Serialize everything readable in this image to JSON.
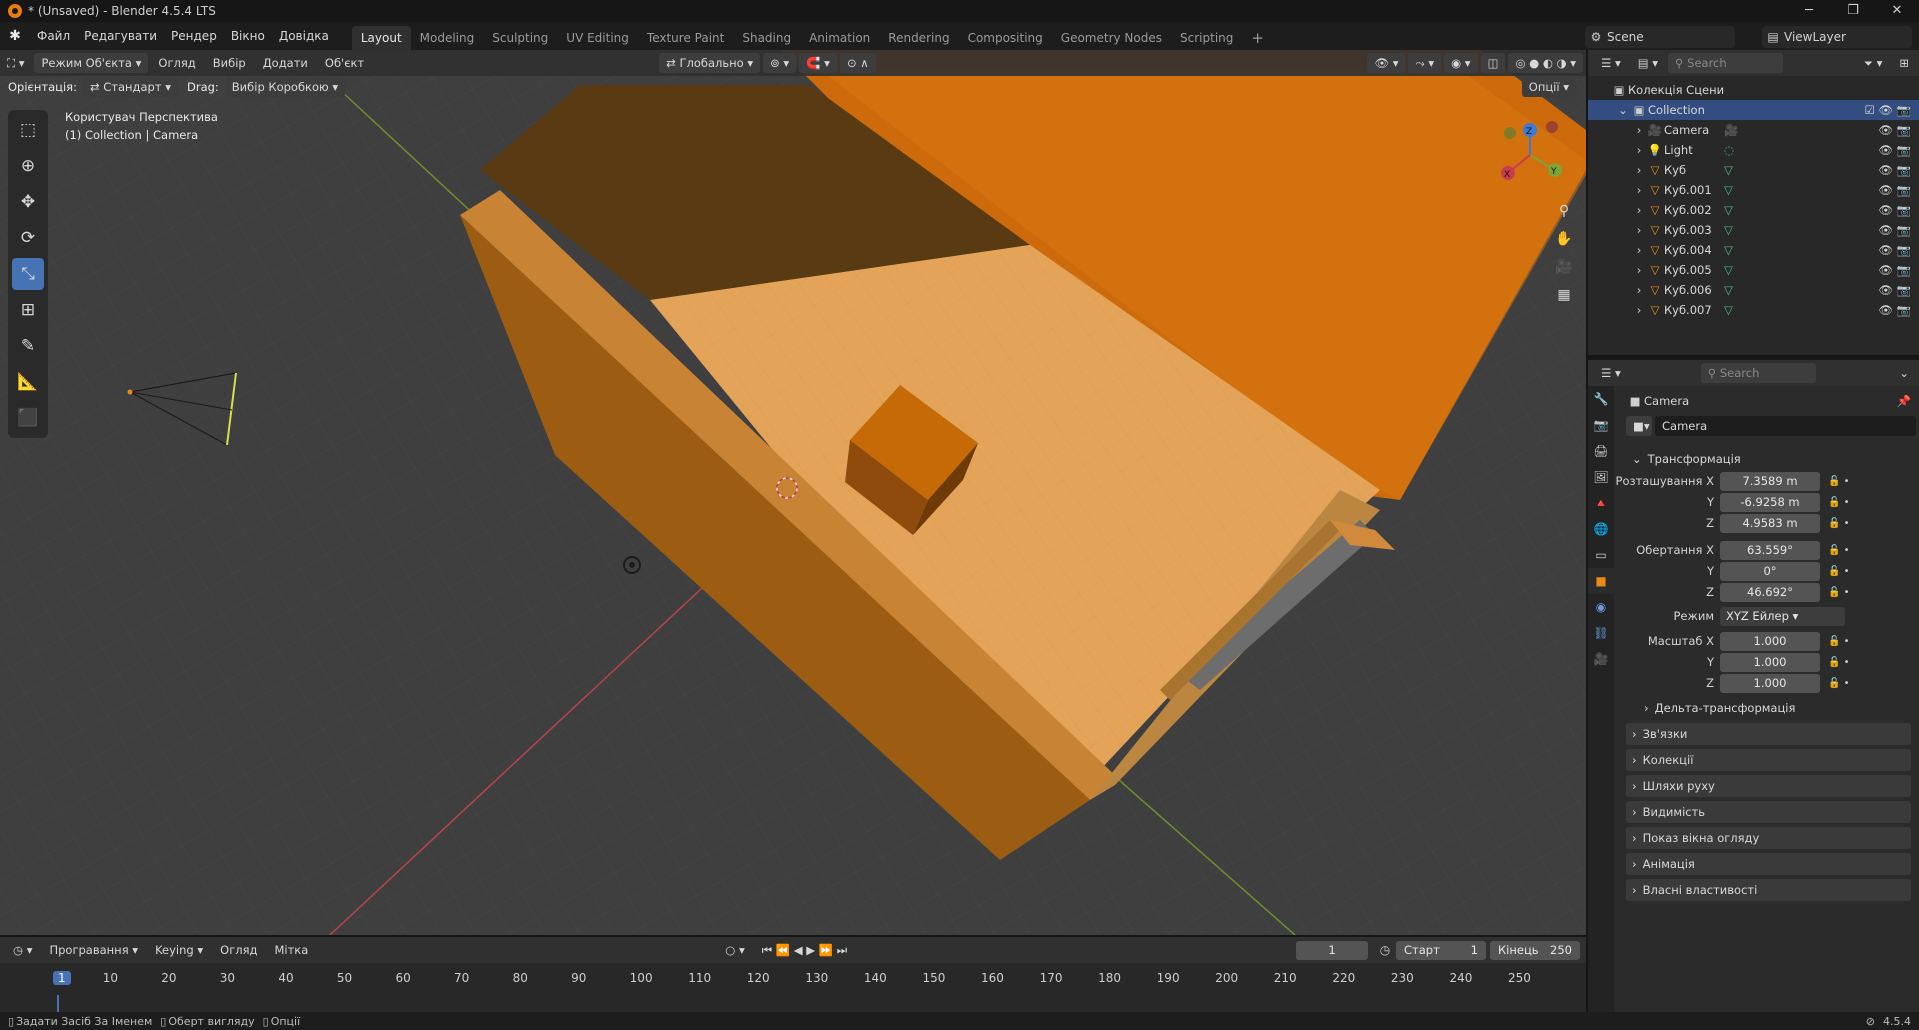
{
  "window": {
    "title": "* (Unsaved) - Blender 4.5.4 LTS"
  },
  "menubar": {
    "items": [
      "Файл",
      "Редагувати",
      "Рендер",
      "Вікно",
      "Довідка"
    ],
    "workspaces": [
      "Layout",
      "Modeling",
      "Sculpting",
      "UV Editing",
      "Texture Paint",
      "Shading",
      "Animation",
      "Rendering",
      "Compositing",
      "Geometry Nodes",
      "Scripting"
    ],
    "active_workspace": "Layout",
    "add_tab": "+",
    "scene": "Scene",
    "view_layer": "ViewLayer"
  },
  "viewport_header": {
    "mode": "Режим Об'єкта",
    "menus": [
      "Огляд",
      "Вибір",
      "Додати",
      "Об'єкт"
    ],
    "transform_orientation": "Глобально",
    "orientation_label": "Орієнтація:",
    "orientation_value": "Стандарт",
    "drag_label": "Drag:",
    "drag_value": "Вибір Коробкою",
    "options": "Опції"
  },
  "viewport": {
    "view_name": "Користувач Перспектива",
    "context": "(1) Collection | Camera",
    "gizmo_axes": [
      "X",
      "Y",
      "Z"
    ]
  },
  "outliner": {
    "search_placeholder": "Search",
    "scene_collection": "Колекція Сцени",
    "collection": "Collection",
    "items": [
      "Camera",
      "Light",
      "Куб",
      "Куб.001",
      "Куб.002",
      "Куб.003",
      "Куб.004",
      "Куб.005",
      "Куб.006",
      "Куб.007"
    ]
  },
  "properties": {
    "search_placeholder": "Search",
    "object_name": "Camera",
    "object_datablock": "Camera",
    "transform_panel": "Трансформація",
    "location_label": "Розташування X",
    "rotation_label": "Обертання X",
    "scale_label": "Масштаб X",
    "y_label": "Y",
    "z_label": "Z",
    "location": [
      "7.3589 m",
      "-6.9258 m",
      "4.9583 m"
    ],
    "rotation": [
      "63.559°",
      "0°",
      "46.692°"
    ],
    "mode_label": "Режим",
    "rotation_mode": "XYZ Ейлер",
    "scale": [
      "1.000",
      "1.000",
      "1.000"
    ],
    "delta": "Дельта-трансформація",
    "panels": [
      "Зв'язки",
      "Колекції",
      "Шляхи руху",
      "Видимість",
      "Показ вікна огляду",
      "Анімація",
      "Власні властивості"
    ]
  },
  "timeline": {
    "menus": [
      "Програвання",
      "Keying",
      "Огляд",
      "Мітка"
    ],
    "current_frame": "1",
    "start_label": "Старт",
    "start": "1",
    "end_label": "Кінець",
    "end": "250",
    "ticks": [
      "1",
      "10",
      "20",
      "30",
      "40",
      "50",
      "60",
      "70",
      "80",
      "90",
      "100",
      "110",
      "120",
      "130",
      "140",
      "150",
      "160",
      "170",
      "180",
      "190",
      "200",
      "210",
      "220",
      "230",
      "240",
      "250"
    ]
  },
  "statusbar": {
    "hints": [
      "Задати Засіб За Іменем",
      "Оберт вигляду",
      "Опції"
    ],
    "version": "4.5.4"
  },
  "colors": {
    "accent": "#4772b3",
    "object": "#e87d0d",
    "background": "#3f3f3f"
  }
}
